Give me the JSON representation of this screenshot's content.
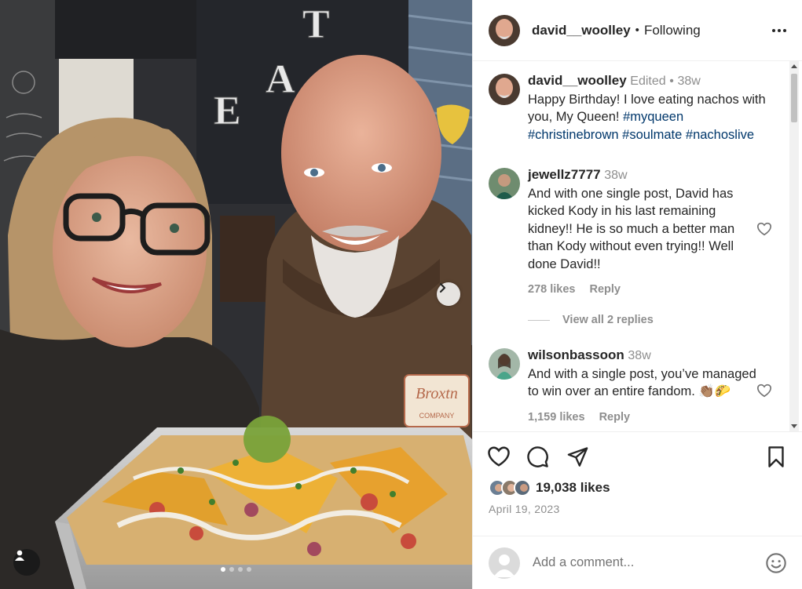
{
  "post": {
    "author": "david__woolley",
    "follow_status": "Following",
    "separator": "•",
    "carousel_count": 4,
    "carousel_active": 0
  },
  "caption": {
    "username": "david__woolley",
    "edited": "Edited",
    "dot": "•",
    "age": "38w",
    "text": "Happy Birthday! I love eating nachos with you, My Queen! ",
    "hashtags": [
      "#myqueen",
      "#christinebrown",
      "#soulmate",
      "#nachoslive"
    ]
  },
  "comments": [
    {
      "username": "jewellz7777",
      "age": "38w",
      "text": "And with one single post, David has kicked Kody in his last remaining kidney!! He is so much a better man than Kody without even trying!! Well done David!!",
      "likes": "278 likes",
      "reply_label": "Reply",
      "view_replies": "View all 2 replies"
    },
    {
      "username": "wilsonbassoon",
      "age": "38w",
      "text": "And with a single post, you’ve managed to win over an entire fandom. 👏🏽🌮",
      "likes": "1,159 likes",
      "reply_label": "Reply"
    }
  ],
  "engagement": {
    "likes": "19,038 likes",
    "date": "April 19, 2023"
  },
  "composer": {
    "placeholder": "Add a comment..."
  },
  "icons": {
    "like": "heart-icon",
    "comment": "comment-bubble-icon",
    "share": "paper-plane-icon",
    "save": "bookmark-icon",
    "more": "more-options-icon",
    "emoji": "emoji-smiley-icon",
    "next": "chevron-right-icon",
    "tag": "user-tag-icon"
  },
  "photo_sign": {
    "letters": [
      "E",
      "A",
      "T"
    ]
  },
  "photo_hoodie_logo": {
    "brand": "Broxtn",
    "sub": "COMPANY"
  }
}
